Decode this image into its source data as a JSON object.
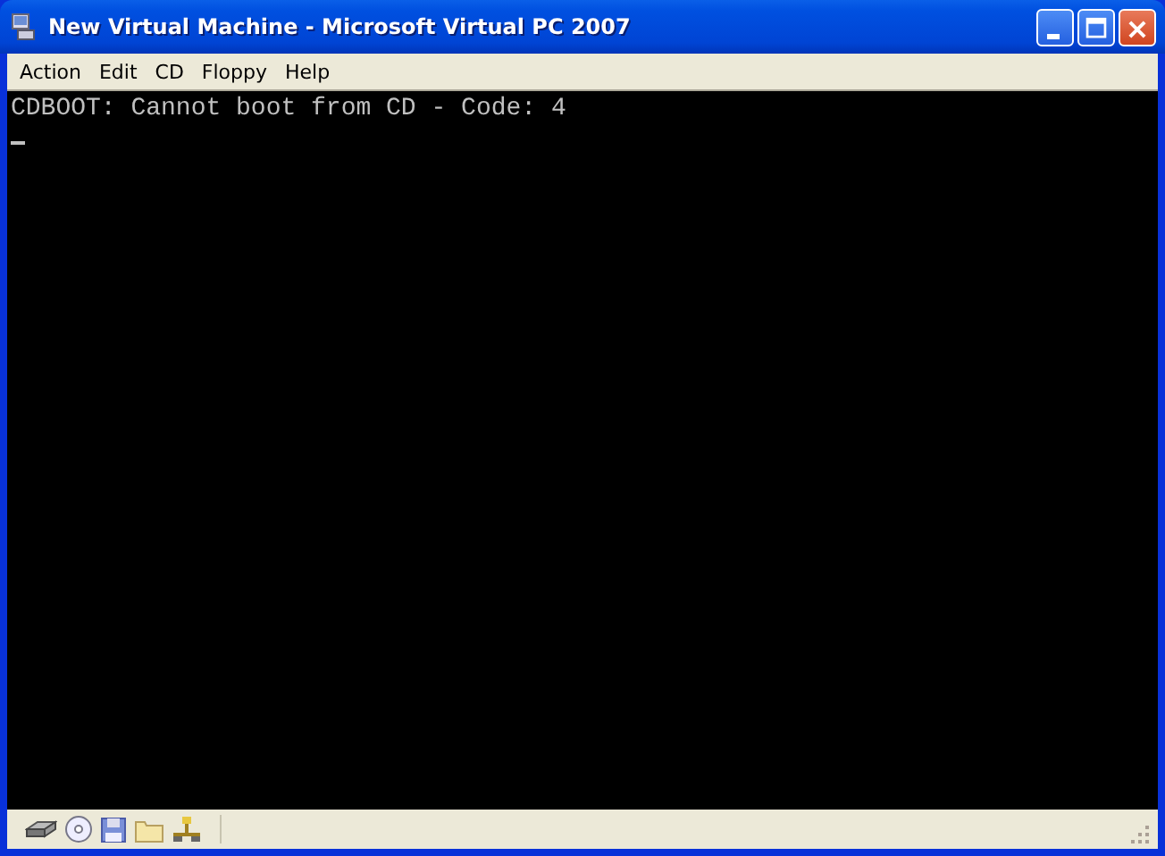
{
  "window": {
    "title": "New Virtual Machine - Microsoft Virtual PC 2007"
  },
  "menu": [
    "Action",
    "Edit",
    "CD",
    "Floppy",
    "Help"
  ],
  "screen": {
    "lines": [
      "CDBOOT: Cannot boot from CD - Code: 4"
    ],
    "cursor": true
  }
}
